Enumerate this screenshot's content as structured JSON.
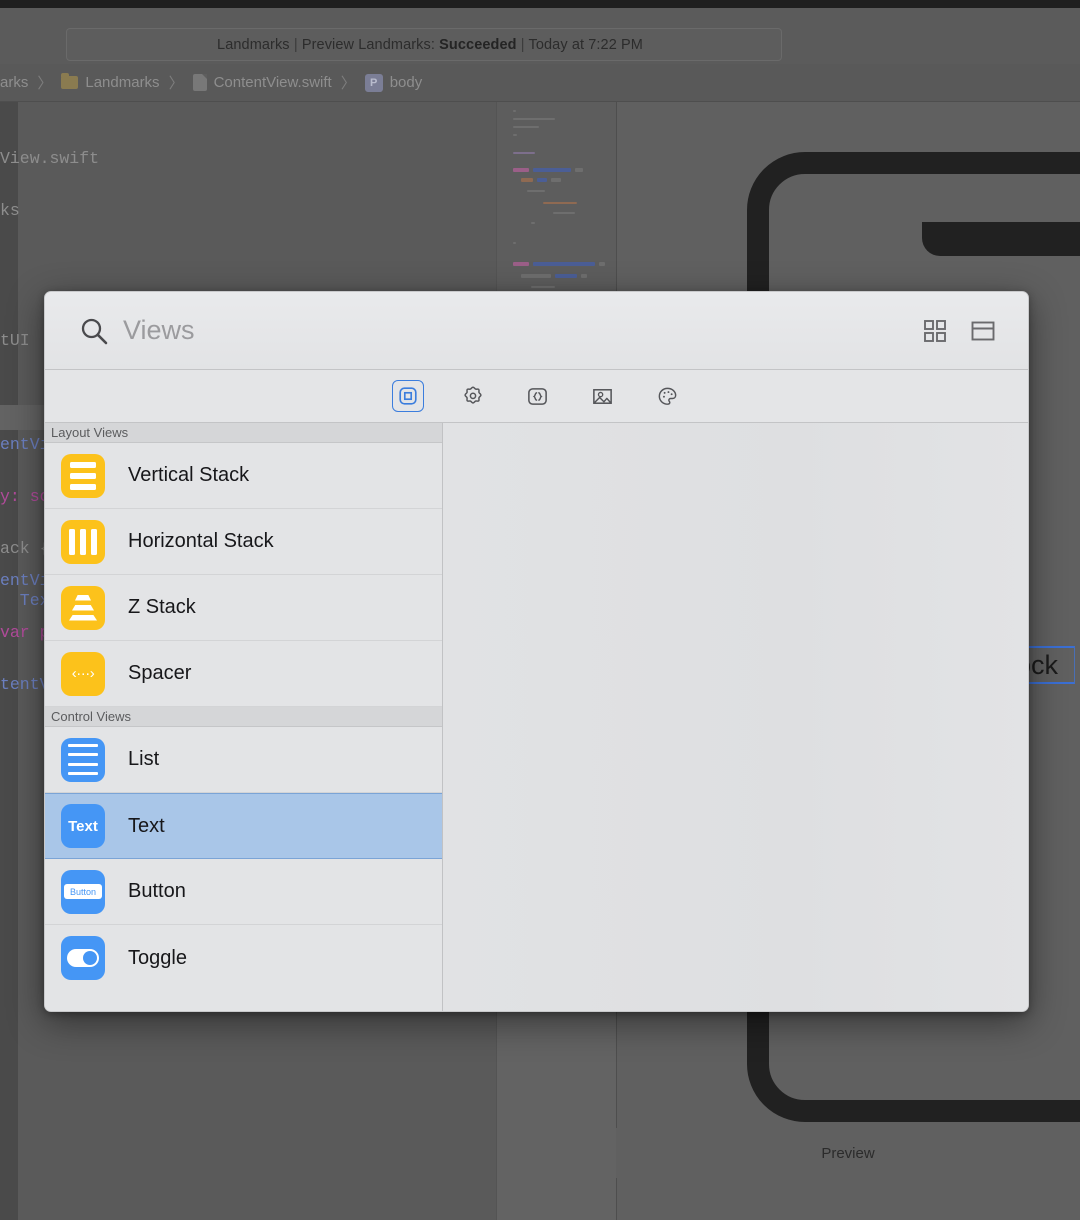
{
  "status_bar": {
    "project": "Landmarks",
    "separator": "|",
    "scheme": "Preview Landmarks:",
    "result": "Succeeded",
    "time": "Today at 7:22 PM",
    "full": "Landmarks | Preview Landmarks: Succeeded | Today at 7:22 PM"
  },
  "breadcrumb": {
    "items": [
      {
        "label": "arks",
        "icon": "none"
      },
      {
        "label": "Landmarks",
        "icon": "folder-icon"
      },
      {
        "label": "ContentView.swift",
        "icon": "swift-file-icon"
      },
      {
        "label": "body",
        "icon": "property-icon"
      }
    ],
    "separator": "〉",
    "property_badge": "P"
  },
  "editor": {
    "code_lines": [
      "View.swift",
      "ks",
      "",
      "",
      "tUI",
      "",
      "entVi",
      "y: so",
      "ack {",
      "  Text"
    ],
    "code_lines_lower": [
      "entVi",
      "var p",
      "tentV"
    ]
  },
  "preview": {
    "label": "Preview",
    "selected_text_fragment": "ock"
  },
  "library": {
    "search": {
      "placeholder": "Views",
      "value": "",
      "icon": "search-icon"
    },
    "view_modes": [
      {
        "name": "grid-view-icon",
        "label": "Grid"
      },
      {
        "name": "detail-view-icon",
        "label": "Detail"
      }
    ],
    "tabs": [
      {
        "name": "views-tab",
        "icon": "square-in-square-icon",
        "label": "Views",
        "selected": true
      },
      {
        "name": "modifiers-tab",
        "icon": "gear-icon",
        "label": "Modifiers",
        "selected": false
      },
      {
        "name": "snippets-tab",
        "icon": "braces-icon",
        "label": "Snippets",
        "selected": false
      },
      {
        "name": "media-tab",
        "icon": "image-icon",
        "label": "Media",
        "selected": false
      },
      {
        "name": "colors-tab",
        "icon": "palette-icon",
        "label": "Colors",
        "selected": false
      }
    ],
    "groups": [
      {
        "title": "Layout Views",
        "items": [
          {
            "label": "Vertical Stack",
            "icon": "vertical-stack-icon",
            "color": "yellow",
            "selected": false
          },
          {
            "label": "Horizontal Stack",
            "icon": "horizontal-stack-icon",
            "color": "yellow",
            "selected": false
          },
          {
            "label": "Z Stack",
            "icon": "z-stack-icon",
            "color": "yellow",
            "selected": false
          },
          {
            "label": "Spacer",
            "icon": "spacer-icon",
            "color": "yellow",
            "selected": false
          }
        ]
      },
      {
        "title": "Control Views",
        "items": [
          {
            "label": "List",
            "icon": "list-icon",
            "color": "blue",
            "selected": false
          },
          {
            "label": "Text",
            "icon": "text-icon",
            "color": "blue",
            "selected": true
          },
          {
            "label": "Button",
            "icon": "button-icon",
            "color": "blue",
            "selected": false
          },
          {
            "label": "Toggle",
            "icon": "toggle-icon",
            "color": "blue",
            "selected": false
          }
        ]
      }
    ],
    "glyphs": {
      "text_icon_label": "Text",
      "button_icon_label": "Button",
      "spacer_icon_label": "‹···›"
    }
  },
  "colors": {
    "accent_blue": "#3b7ddd",
    "selection_blue": "#a9c6e8",
    "icon_yellow": "#fcc21b",
    "icon_blue": "#4596f5",
    "panel_bg": "#e3e4e6"
  }
}
